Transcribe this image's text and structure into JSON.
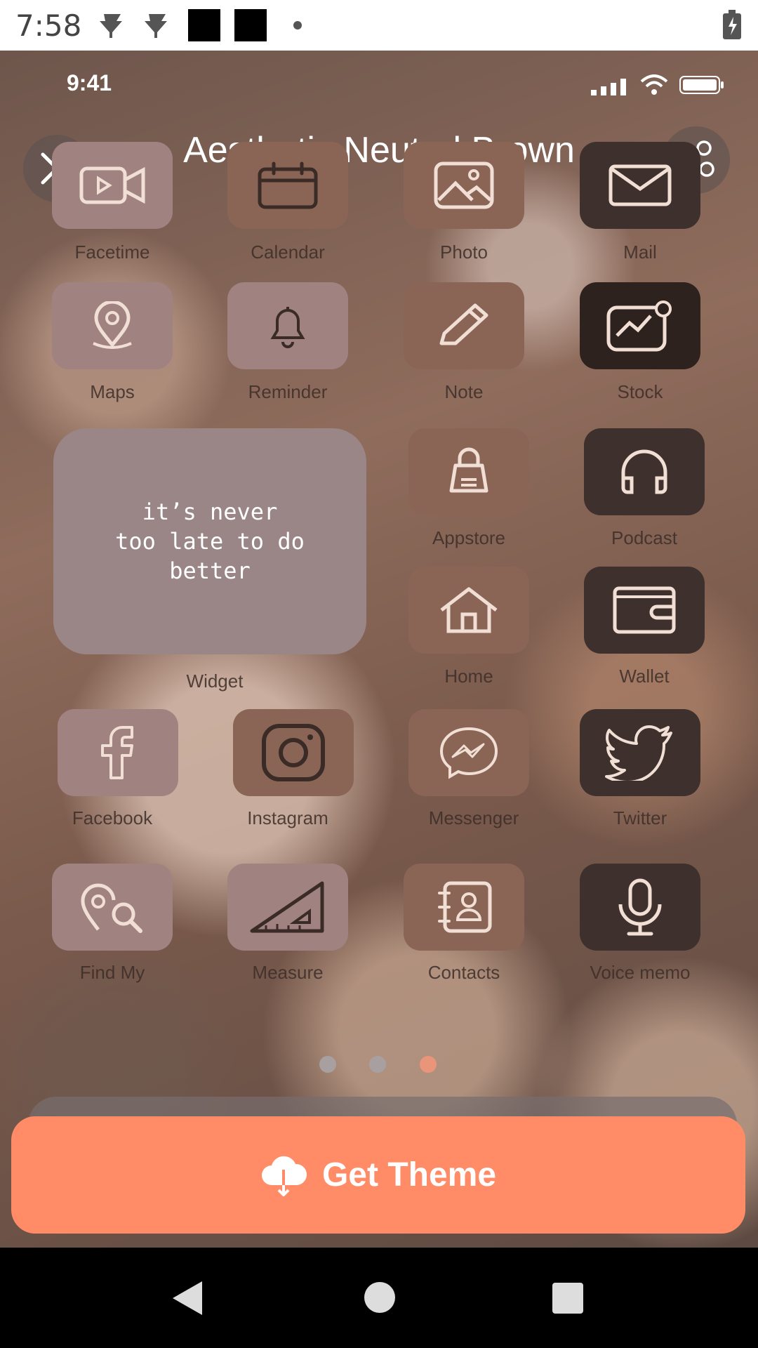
{
  "system_status": {
    "time": "7:58"
  },
  "preview_status": {
    "time": "9:41"
  },
  "header": {
    "title": "Aesthetic Neutral Brown"
  },
  "apps": [
    {
      "label": "Facetime",
      "icon": "video-camera-icon"
    },
    {
      "label": "Calendar",
      "icon": "calendar-icon"
    },
    {
      "label": "Photo",
      "icon": "photo-icon"
    },
    {
      "label": "Mail",
      "icon": "mail-icon"
    },
    {
      "label": "Maps",
      "icon": "map-pin-icon"
    },
    {
      "label": "Reminder",
      "icon": "bell-icon"
    },
    {
      "label": "Note",
      "icon": "pencil-icon"
    },
    {
      "label": "Stock",
      "icon": "stock-chart-icon"
    },
    {
      "label": "Appstore",
      "icon": "shopping-bag-icon"
    },
    {
      "label": "Podcast",
      "icon": "headphones-icon"
    },
    {
      "label": "Home",
      "icon": "house-icon"
    },
    {
      "label": "Wallet",
      "icon": "wallet-icon"
    },
    {
      "label": "Facebook",
      "icon": "facebook-icon"
    },
    {
      "label": "Instagram",
      "icon": "instagram-icon"
    },
    {
      "label": "Messenger",
      "icon": "messenger-icon"
    },
    {
      "label": "Twitter",
      "icon": "twitter-icon"
    },
    {
      "label": "Find My",
      "icon": "find-my-icon"
    },
    {
      "label": "Measure",
      "icon": "ruler-triangle-icon"
    },
    {
      "label": "Contacts",
      "icon": "contacts-book-icon"
    },
    {
      "label": "Voice memo",
      "icon": "microphone-icon"
    }
  ],
  "widget": {
    "text": "it’s never\ntoo late to do\nbetter",
    "label": "Widget"
  },
  "pager": {
    "count": 3,
    "active_index": 2
  },
  "cta": {
    "label": "Get Theme",
    "icon": "cloud-download-icon"
  },
  "colors": {
    "accent": "#ff8c66",
    "dot_active": "#e8957a",
    "dot_inactive": "#a8a0a0"
  }
}
